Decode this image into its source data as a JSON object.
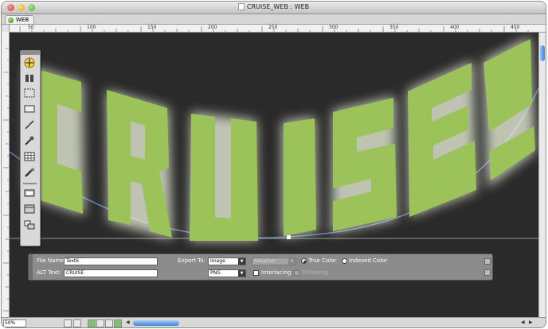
{
  "window": {
    "title": "CRUISE_WEB : WEB"
  },
  "tab": {
    "label": "WEB"
  },
  "ruler": {
    "marks": [
      "50",
      "100",
      "150",
      "200",
      "250",
      "300",
      "350",
      "400",
      "450"
    ]
  },
  "artwork": {
    "text": "CRUISE",
    "letter_color": "#9bc35a",
    "glow_color": "#f1f7e0",
    "path_color": "#5f7fb6",
    "background": "#2a2a2a"
  },
  "props": {
    "file_name_label": "File Name:",
    "file_name_value": "Text6",
    "alt_text_label": "ALT Text:",
    "alt_text_value": "CRUISE",
    "export_to_label": "Export To:",
    "export_to_value": "Image",
    "format_value": "PNG",
    "palette_value": "Adaptive",
    "true_color_label": "True Color",
    "indexed_color_label": "Indexed Color",
    "color_mode": "True Color",
    "interlacing_label": "Interlacing",
    "interlacing_checked": false,
    "dithering_label": "Dithering",
    "dithering_checked": false
  },
  "status": {
    "zoom": "50%"
  }
}
